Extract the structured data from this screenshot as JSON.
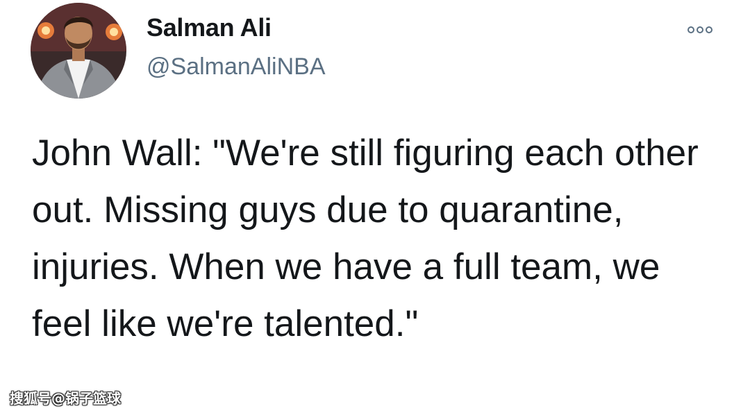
{
  "tweet": {
    "display_name": "Salman Ali",
    "handle": "@SalmanAliNBA",
    "text": "John Wall: \"We're still figuring each other out. Missing guys due to quarantine, injuries. When we have a full team, we feel like we're talented.\"",
    "avatar_icon": "profile-photo",
    "more_icon": "more-options-icon"
  },
  "watermark": {
    "text": "搜狐号@锅子篮球"
  }
}
